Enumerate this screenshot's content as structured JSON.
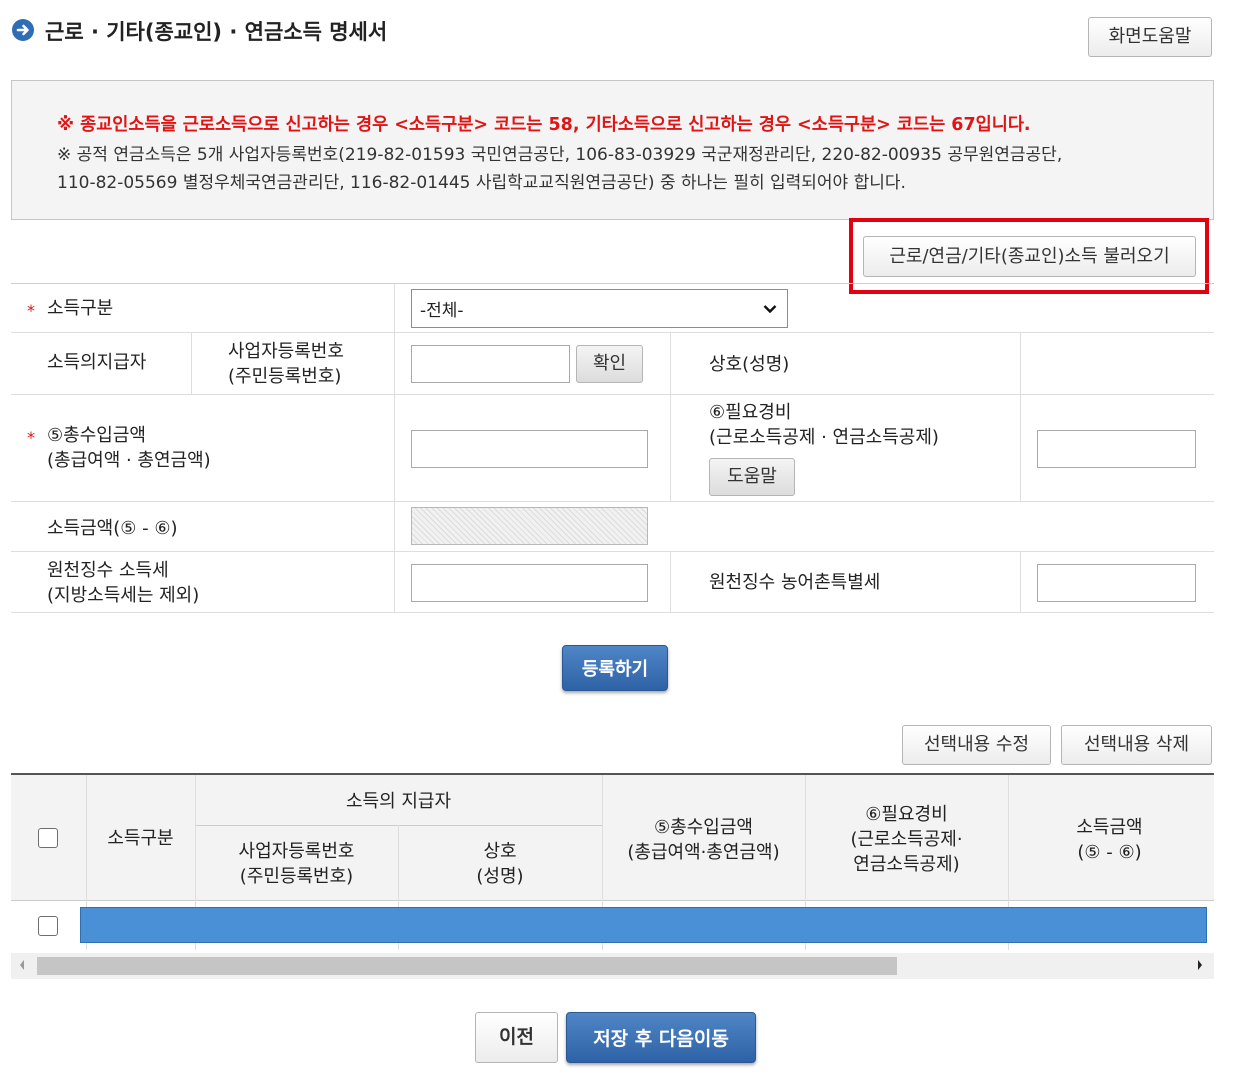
{
  "header": {
    "title": "근로 · 기타(종교인) · 연금소득 명세서",
    "help_label": "화면도움말"
  },
  "notice": {
    "line1": "※ 종교인소득을 근로소득으로 신고하는 경우 <소득구분> 코드는 58, 기타소득으로 신고하는 경우 <소득구분> 코드는 67입니다.",
    "line2": "※ 공적 연금소득은 5개 사업자등록번호(219-82-01593 국민연금공단, 106-83-03929 국군재정관리단, 220-82-00935 공무원연금공단,",
    "line3": "110-82-05569 별정우체국연금관리단, 116-82-01445 사립학교교직원연금공단) 중 하나는 필히 입력되어야 합니다."
  },
  "load_button_label": "근로/연금/기타(종교인)소득 불러오기",
  "form": {
    "income_type_label": "소득구분",
    "income_type_value": "-전체-",
    "payer_label": "소득의지급자",
    "reg_no_label_1": "사업자등록번호",
    "reg_no_label_2": "(주민등록번호)",
    "confirm_label": "확인",
    "trade_name_label": "상호(성명)",
    "total_income_label_1": "⑤총수입금액",
    "total_income_label_2": "(총급여액 · 총연금액)",
    "expense_label_1": "⑥필요경비",
    "expense_label_2": "(근로소득공제 · 연금소득공제)",
    "expense_help_label": "도움말",
    "income_amount_label": "소득금액(⑤ - ⑥)",
    "withholding_tax_label_1": "원천징수 소득세",
    "withholding_tax_label_2": "(지방소득세는 제외)",
    "rural_tax_label": "원천징수 농어촌특별세",
    "required_mark": "*"
  },
  "register_label": "등록하기",
  "grid_actions": {
    "edit_label": "선택내용 수정",
    "delete_label": "선택내용 삭제"
  },
  "grid": {
    "col_income_type": "소득구분",
    "col_payer_group": "소득의 지급자",
    "col_reg_no_1": "사업자등록번호",
    "col_reg_no_2": "(주민등록번호)",
    "col_trade_1": "상호",
    "col_trade_2": "(성명)",
    "col_total_1": "⑤총수입금액",
    "col_total_2": "(총급여액·총연금액)",
    "col_expense_1": "⑥필요경비",
    "col_expense_2": "(근로소득공제·",
    "col_expense_3": "연금소득공제)",
    "col_amount_1": "소득금액",
    "col_amount_2": "(⑤ - ⑥)"
  },
  "footer": {
    "prev_label": "이전",
    "save_next_label": "저장 후 다음이동"
  },
  "colors": {
    "accent_blue": "#2e62a6",
    "notice_red": "#e01414",
    "highlight_red": "#e3000f",
    "selected_row": "#4a90d6"
  },
  "icons": [
    "arrow-circle-icon",
    "chevron-down-icon",
    "scroll-left-icon",
    "scroll-right-icon"
  ]
}
